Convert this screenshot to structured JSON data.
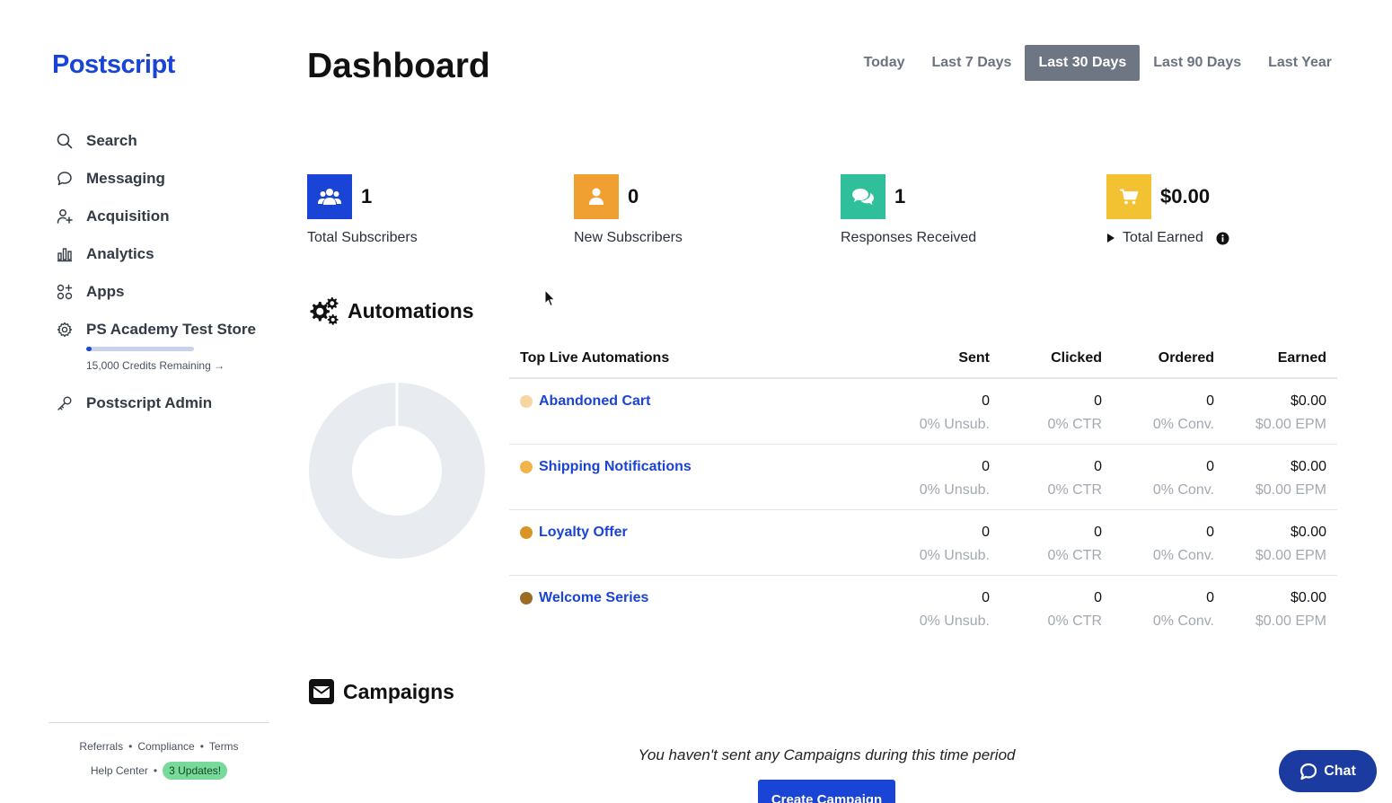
{
  "brand": {
    "name": "Postscript",
    "color": "#1a44d6"
  },
  "sidebar": {
    "items": [
      {
        "label": "Search",
        "icon": "search-icon"
      },
      {
        "label": "Messaging",
        "icon": "chat-bubble-icon"
      },
      {
        "label": "Acquisition",
        "icon": "add-user-icon"
      },
      {
        "label": "Analytics",
        "icon": "bar-chart-icon"
      },
      {
        "label": "Apps",
        "icon": "apps-grid-icon"
      },
      {
        "label": "PS Academy Test Store",
        "icon": "gear-icon"
      },
      {
        "label": "Postscript Admin",
        "icon": "key-icon"
      }
    ],
    "credits": {
      "text": "15,000 Credits Remaining →",
      "used_fraction": 0.05
    },
    "footer": {
      "referrals": "Referrals",
      "compliance": "Compliance",
      "terms": "Terms",
      "help_center": "Help Center",
      "updates_badge": "3 Updates!"
    }
  },
  "header": {
    "title": "Dashboard",
    "ranges": [
      "Today",
      "Last 7 Days",
      "Last 30 Days",
      "Last 90 Days",
      "Last Year"
    ],
    "active_range": "Last 30 Days"
  },
  "stats": [
    {
      "value": "1",
      "label": "Total Subscribers",
      "icon": "users-icon",
      "color": "#1a44d6"
    },
    {
      "value": "0",
      "label": "New Subscribers",
      "icon": "user-icon",
      "color": "#f0a030"
    },
    {
      "value": "1",
      "label": "Responses Received",
      "icon": "comments-icon",
      "color": "#2fbf9b"
    },
    {
      "value": "$0.00",
      "label": "Total Earned",
      "icon": "cart-icon",
      "color": "#f2c233"
    }
  ],
  "automations": {
    "title": "Automations",
    "table": {
      "headers": [
        "Top Live Automations",
        "Sent",
        "Clicked",
        "Ordered",
        "Earned"
      ],
      "rows": [
        {
          "name": "Abandoned Cart",
          "dot_color": "#f5d6a3",
          "sent": "0",
          "sent_sub": "0% Unsub.",
          "clicked": "0",
          "clicked_sub": "0% CTR",
          "ordered": "0",
          "ordered_sub": "0% Conv.",
          "earned": "$0.00",
          "earned_sub": "$0.00 EPM"
        },
        {
          "name": "Shipping Notifications",
          "dot_color": "#f0b44a",
          "sent": "0",
          "sent_sub": "0% Unsub.",
          "clicked": "0",
          "clicked_sub": "0% CTR",
          "ordered": "0",
          "ordered_sub": "0% Conv.",
          "earned": "$0.00",
          "earned_sub": "$0.00 EPM"
        },
        {
          "name": "Loyalty Offer",
          "dot_color": "#d99426",
          "sent": "0",
          "sent_sub": "0% Unsub.",
          "clicked": "0",
          "clicked_sub": "0% CTR",
          "ordered": "0",
          "ordered_sub": "0% Conv.",
          "earned": "$0.00",
          "earned_sub": "$0.00 EPM"
        },
        {
          "name": "Welcome Series",
          "dot_color": "#9c6c25",
          "sent": "0",
          "sent_sub": "0% Unsub.",
          "clicked": "0",
          "clicked_sub": "0% CTR",
          "ordered": "0",
          "ordered_sub": "0% Conv.",
          "earned": "$0.00",
          "earned_sub": "$0.00 EPM"
        }
      ]
    }
  },
  "campaigns": {
    "title": "Campaigns",
    "empty_message": "You haven't sent any Campaigns during this time period",
    "create_button": "Create Campaign"
  },
  "chat": {
    "label": "Chat"
  }
}
